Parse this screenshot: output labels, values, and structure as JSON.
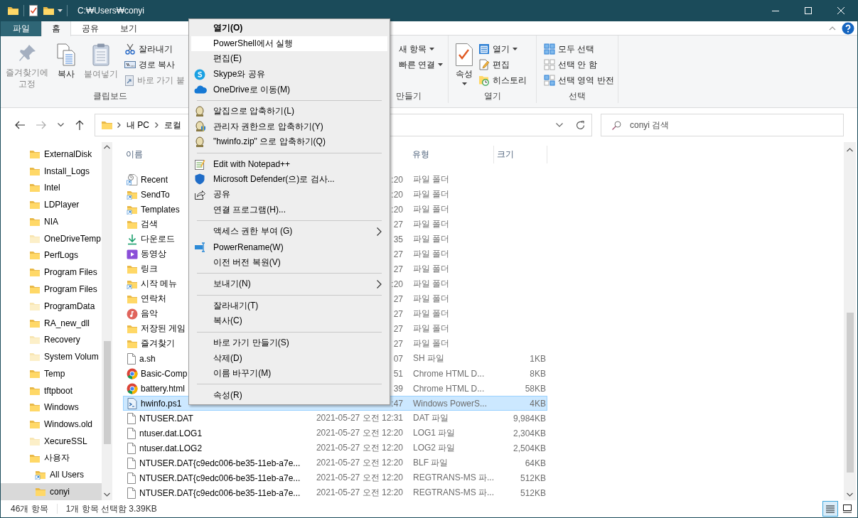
{
  "title_bar": {
    "path": "C:₩Users₩conyi"
  },
  "ribbon_tabs": [
    {
      "label": "파일",
      "kind": "file",
      "selected": false
    },
    {
      "label": "홈",
      "kind": "tab",
      "selected": true
    },
    {
      "label": "공유",
      "kind": "tab",
      "selected": false
    },
    {
      "label": "보기",
      "kind": "tab",
      "selected": false
    }
  ],
  "ribbon": {
    "clipboard": {
      "label": "클립보드",
      "large": [
        {
          "label": "즐겨찾기에\n고정",
          "disabled": true
        },
        {
          "label": "복사",
          "disabled": false
        },
        {
          "label": "붙여넣기",
          "disabled": true
        }
      ],
      "small": [
        {
          "label": "잘라내기",
          "disabled": false
        },
        {
          "label": "경로 복사",
          "disabled": false
        },
        {
          "label": "바로 가기 붙",
          "disabled": true
        }
      ]
    },
    "new": {
      "label": "만들기",
      "small": [
        {
          "label": "새 항목",
          "dropdown": true
        },
        {
          "label": "빠른 연결",
          "dropdown": true
        }
      ]
    },
    "open": {
      "label": "열기",
      "large": {
        "label": "속성",
        "dropdown": true
      },
      "small": [
        {
          "label": "열기",
          "dropdown": true
        },
        {
          "label": "편집",
          "dropdown": false
        },
        {
          "label": "히스토리",
          "dropdown": false
        }
      ]
    },
    "select": {
      "label": "선택",
      "small": [
        {
          "label": "모두 선택",
          "disabled": false
        },
        {
          "label": "선택 안 함",
          "disabled": false
        },
        {
          "label": "선택 영역 반전",
          "disabled": false
        }
      ]
    }
  },
  "address_bar": {
    "crumbs": [
      "내 PC",
      "로컬"
    ]
  },
  "search": {
    "placeholder": "conyi 검색"
  },
  "tree": [
    {
      "label": "ExternalDisk",
      "kind": "folder",
      "selected": false
    },
    {
      "label": "Install_Logs",
      "kind": "folder",
      "selected": false
    },
    {
      "label": "Intel",
      "kind": "folder",
      "selected": false
    },
    {
      "label": "LDPlayer",
      "kind": "folder",
      "selected": false
    },
    {
      "label": "NIA",
      "kind": "folder",
      "selected": false
    },
    {
      "label": "OneDriveTemp",
      "kind": "hidden-folder",
      "selected": false
    },
    {
      "label": "PerfLogs",
      "kind": "folder",
      "selected": false
    },
    {
      "label": "Program Files",
      "kind": "folder",
      "selected": false
    },
    {
      "label": "Program Files",
      "kind": "folder",
      "selected": false
    },
    {
      "label": "ProgramData",
      "kind": "hidden-folder",
      "selected": false
    },
    {
      "label": "RA_new_dll",
      "kind": "folder",
      "selected": false
    },
    {
      "label": "Recovery",
      "kind": "hidden-folder",
      "selected": false
    },
    {
      "label": "System Volum",
      "kind": "hidden-folder",
      "selected": false
    },
    {
      "label": "Temp",
      "kind": "folder",
      "selected": false
    },
    {
      "label": "tftpboot",
      "kind": "folder",
      "selected": false
    },
    {
      "label": "Windows",
      "kind": "folder",
      "selected": false
    },
    {
      "label": "Windows.old",
      "kind": "folder",
      "selected": false
    },
    {
      "label": "XecureSSL",
      "kind": "hidden-folder",
      "selected": false
    },
    {
      "label": "사용자",
      "kind": "folder",
      "selected": false,
      "children": [
        {
          "label": "All Users",
          "kind": "shortcut-folder",
          "selected": false
        },
        {
          "label": "conyi",
          "kind": "folder",
          "selected": true
        }
      ]
    }
  ],
  "file_list": {
    "columns": [
      "이름",
      "유형",
      "크기"
    ],
    "rows": [
      {
        "name": "Recent",
        "date": ":20",
        "type": "파일 폴더",
        "kind": "recent",
        "selected": false
      },
      {
        "name": "SendTo",
        "date": ":20",
        "type": "파일 폴더",
        "kind": "shortcut-folder",
        "selected": false
      },
      {
        "name": "Templates",
        "date": ":20",
        "type": "파일 폴더",
        "kind": "shortcut-folder",
        "selected": false
      },
      {
        "name": "검색",
        "date": "27",
        "type": "파일 폴더",
        "kind": "folder",
        "selected": false
      },
      {
        "name": "다운로드",
        "date": "35",
        "type": "파일 폴더",
        "kind": "download",
        "selected": false
      },
      {
        "name": "동영상",
        "date": "27",
        "type": "파일 폴더",
        "kind": "video",
        "selected": false
      },
      {
        "name": "링크",
        "date": "27",
        "type": "파일 폴더",
        "kind": "folder",
        "selected": false
      },
      {
        "name": "시작 메뉴",
        "date": ":20",
        "type": "파일 폴더",
        "kind": "shortcut-folder",
        "selected": false
      },
      {
        "name": "연락처",
        "date": "27",
        "type": "파일 폴더",
        "kind": "folder",
        "selected": false
      },
      {
        "name": "음악",
        "date": "27",
        "type": "파일 폴더",
        "kind": "music",
        "selected": false
      },
      {
        "name": "저장된 게임",
        "date": "27",
        "type": "파일 폴더",
        "kind": "folder",
        "selected": false
      },
      {
        "name": "즐겨찾기",
        "date": "27",
        "type": "파일 폴더",
        "kind": "folder",
        "selected": false
      },
      {
        "name": "a.sh",
        "date": "07",
        "type": "SH 파일",
        "size": "1KB",
        "kind": "file",
        "selected": false
      },
      {
        "name": "Basic-Comp",
        "date": "51",
        "type": "Chrome HTML D...",
        "size": "8KB",
        "kind": "chrome",
        "selected": false
      },
      {
        "name": "battery.html",
        "date": "39",
        "type": "Chrome HTML D...",
        "size": "58KB",
        "kind": "chrome",
        "selected": false
      },
      {
        "name": "hwinfo.ps1",
        "date": ":47",
        "type": "Windows PowerS...",
        "size": "4KB",
        "kind": "script",
        "selected": true
      },
      {
        "name": "NTUSER.DAT",
        "date": "2021-05-27 오전 12:31",
        "type": "DAT 파일",
        "size": "9,984KB",
        "kind": "file",
        "selected": false
      },
      {
        "name": "ntuser.dat.LOG1",
        "date": "2021-05-27 오전 12:20",
        "type": "LOG1 파일",
        "size": "2,304KB",
        "kind": "file",
        "selected": false
      },
      {
        "name": "ntuser.dat.LOG2",
        "date": "2021-05-27 오전 12:20",
        "type": "LOG2 파일",
        "size": "2,504KB",
        "kind": "file",
        "selected": false
      },
      {
        "name": "NTUSER.DAT{c9edc006-be35-11eb-a7e...",
        "date": "2021-05-27 오전 12:20",
        "type": "BLF 파일",
        "size": "64KB",
        "kind": "file",
        "selected": false
      },
      {
        "name": "NTUSER.DAT{c9edc006-be35-11eb-a7e...",
        "date": "2021-05-27 오전 12:20",
        "type": "REGTRANS-MS 파...",
        "size": "512KB",
        "kind": "file",
        "selected": false
      },
      {
        "name": "NTUSER.DAT{c9edc006-be35-11eb-a7e...",
        "date": "2021-05-27 오전 12:20",
        "type": "REGTRANS-MS 파...",
        "size": "512KB",
        "kind": "file",
        "selected": false
      }
    ]
  },
  "context_menu": {
    "groups": [
      [
        {
          "label": "열기(O)",
          "default": true,
          "highlighted": false,
          "submenu": false
        },
        {
          "label": "PowerShell에서 실행",
          "default": false,
          "highlighted": true,
          "submenu": false
        },
        {
          "label": "편집(E)",
          "default": false,
          "highlighted": false,
          "submenu": false
        },
        {
          "label": "Skype와 공유",
          "default": false,
          "highlighted": false,
          "submenu": false
        },
        {
          "label": "OneDrive로 이동(M)",
          "default": false,
          "highlighted": false,
          "submenu": false
        }
      ],
      [
        {
          "label": "알집으로 압축하기(L)",
          "default": false,
          "highlighted": false,
          "submenu": false
        },
        {
          "label": "관리자 권한으로 압축하기(Y)",
          "default": false,
          "highlighted": false,
          "submenu": false
        },
        {
          "label": "\"hwinfo.zip\" 으로 압축하기(Q)",
          "default": false,
          "highlighted": false,
          "submenu": false
        }
      ],
      [
        {
          "label": "Edit with Notepad++",
          "default": false,
          "highlighted": false,
          "submenu": false
        },
        {
          "label": "Microsoft Defender(으)로 검사...",
          "default": false,
          "highlighted": false,
          "submenu": false
        },
        {
          "label": "공유",
          "default": false,
          "highlighted": false,
          "submenu": false
        },
        {
          "label": "연결 프로그램(H)...",
          "default": false,
          "highlighted": false,
          "submenu": false
        }
      ],
      [
        {
          "label": "액세스 권한 부여 (G)",
          "default": false,
          "highlighted": false,
          "submenu": true
        },
        {
          "label": "PowerRename(W)",
          "default": false,
          "highlighted": false,
          "submenu": false
        },
        {
          "label": "이전 버전 복원(V)",
          "default": false,
          "highlighted": false,
          "submenu": false
        }
      ],
      [
        {
          "label": "보내기(N)",
          "default": false,
          "highlighted": false,
          "submenu": true
        }
      ],
      [
        {
          "label": "잘라내기(T)",
          "default": false,
          "highlighted": false,
          "submenu": false
        },
        {
          "label": "복사(C)",
          "default": false,
          "highlighted": false,
          "submenu": false
        }
      ],
      [
        {
          "label": "바로 가기 만들기(S)",
          "default": false,
          "highlighted": false,
          "submenu": false
        },
        {
          "label": "삭제(D)",
          "default": false,
          "highlighted": false,
          "submenu": false
        },
        {
          "label": "이름 바꾸기(M)",
          "default": false,
          "highlighted": false,
          "submenu": false
        }
      ],
      [
        {
          "label": "속성(R)",
          "default": false,
          "highlighted": false,
          "submenu": false
        }
      ]
    ]
  },
  "status_bar": {
    "item_count": "46개 항목",
    "selection": "1개 항목 선택함 3.39KB",
    "views": [
      {
        "kind": "details",
        "selected": true
      },
      {
        "kind": "large-icons",
        "selected": false
      }
    ]
  }
}
